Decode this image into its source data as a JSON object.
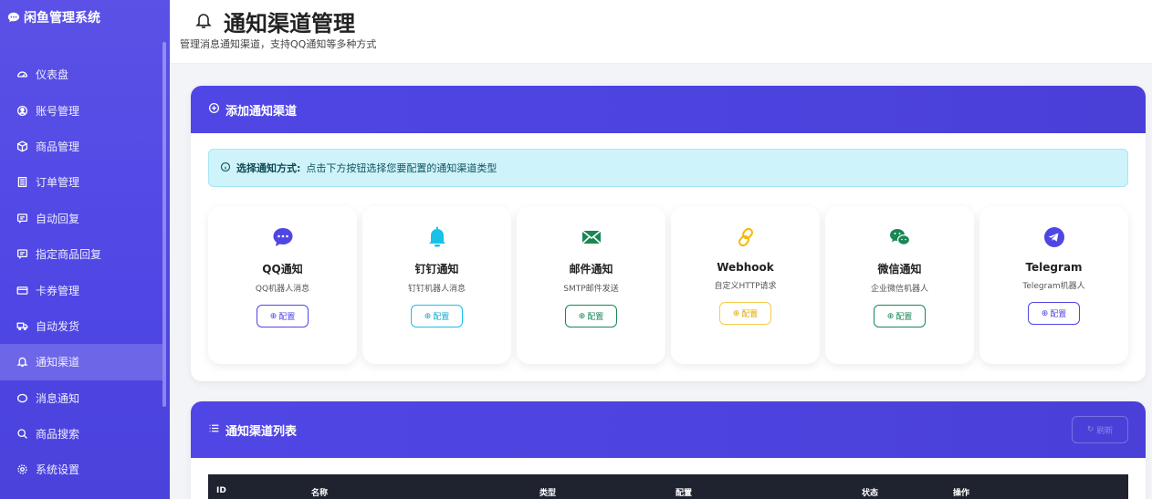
{
  "brand": {
    "title": "闲鱼管理系统",
    "icon": "chat-bubble-icon"
  },
  "sidebar": {
    "items": [
      {
        "label": "仪表盘",
        "icon": "dashboard-icon"
      },
      {
        "label": "账号管理",
        "icon": "user-circle-icon"
      },
      {
        "label": "商品管理",
        "icon": "box-icon"
      },
      {
        "label": "订单管理",
        "icon": "receipt-icon"
      },
      {
        "label": "自动回复",
        "icon": "message-square-icon"
      },
      {
        "label": "指定商品回复",
        "icon": "message-square-icon"
      },
      {
        "label": "卡券管理",
        "icon": "card-icon"
      },
      {
        "label": "自动发货",
        "icon": "truck-icon"
      },
      {
        "label": "通知渠道",
        "icon": "bell-icon",
        "active": true
      },
      {
        "label": "消息通知",
        "icon": "chat-dots-icon"
      },
      {
        "label": "商品搜索",
        "icon": "search-icon"
      },
      {
        "label": "系统设置",
        "icon": "gear-icon"
      }
    ]
  },
  "header": {
    "title": "通知渠道管理",
    "subtitle": "管理消息通知渠道，支持QQ通知等多种方式"
  },
  "add_card": {
    "title": "添加通知渠道",
    "alert_strong": "选择通知方式:",
    "alert_text": "点击下方按钮选择您要配置的通知渠道类型",
    "config_label": "配置",
    "channels": [
      {
        "name": "QQ通知",
        "desc": "QQ机器人消息",
        "color": "#4f46e5",
        "icon": "qq-chat-icon"
      },
      {
        "name": "钉钉通知",
        "desc": "钉钉机器人消息",
        "color": "#17c1e8",
        "icon": "bell-icon"
      },
      {
        "name": "邮件通知",
        "desc": "SMTP邮件发送",
        "color": "#198754",
        "icon": "envelope-icon"
      },
      {
        "name": "Webhook",
        "desc": "自定义HTTP请求",
        "color": "#f5b800",
        "icon": "link-icon"
      },
      {
        "name": "微信通知",
        "desc": "企业微信机器人",
        "color": "#198754",
        "icon": "wechat-icon"
      },
      {
        "name": "Telegram",
        "desc": "Telegram机器人",
        "color": "#4f46e5",
        "icon": "telegram-icon"
      }
    ]
  },
  "list_card": {
    "title": "通知渠道列表",
    "refresh_label": "刷新",
    "columns": [
      "ID",
      "名称",
      "类型",
      "配置",
      "状态",
      "操作"
    ]
  }
}
